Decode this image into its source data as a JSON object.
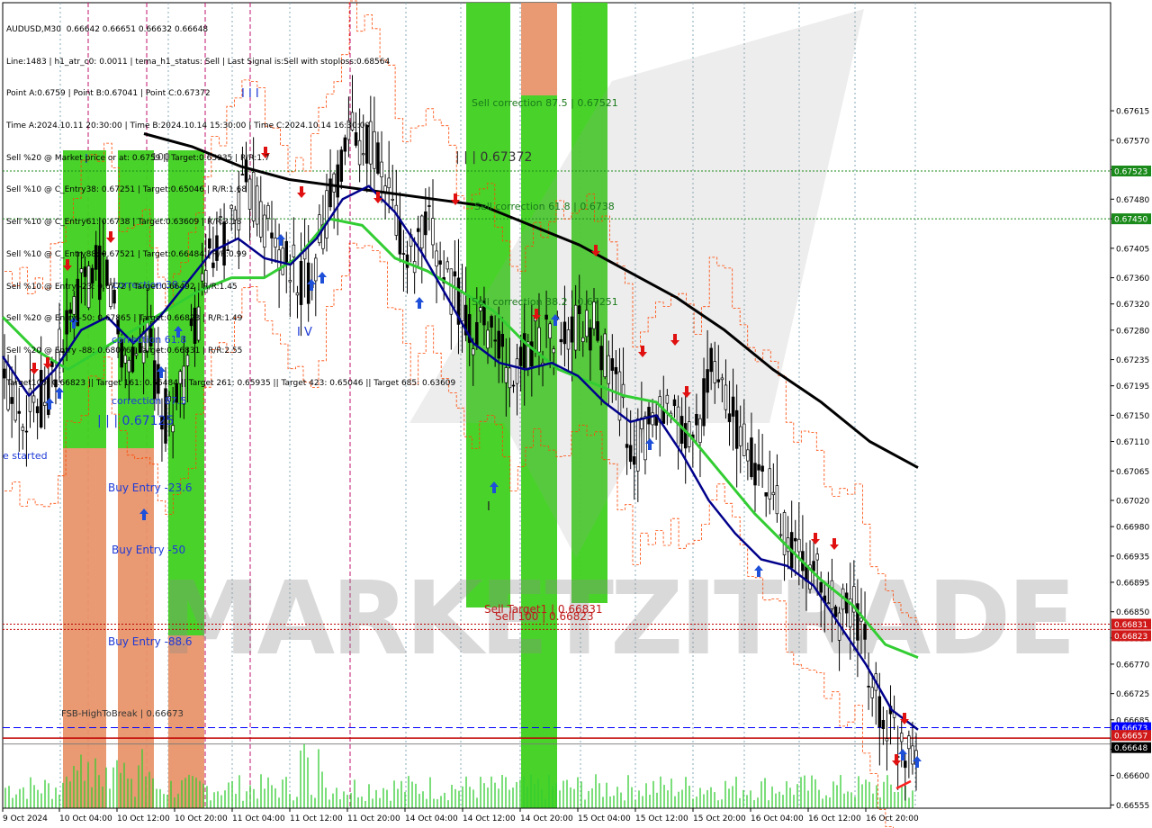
{
  "header": {
    "lines": [
      "AUDUSD,M30  0.66642 0.66651 0.66632 0.66648",
      "Line:1483 | h1_atr_c0: 0.0011 | tema_h1_status: Sell | Last Signal is:Sell with stoploss:0.68564",
      "Point A:0.6759 | Point B:0.67041 | Point C:0.67372",
      "Time A:2024.10.11 20:30:00 | Time B:2024.10.14 15:30:00 | Time C:2024.10.14 16:30:00",
      "Sell %20 @ Market price or at: 0.6759 || Target:0.65935 | R/R:1.7",
      "Sell %10 @ C_Entry38: 0.67251 | Target:0.65046 | R/R:1.68",
      "Sell %10 @ C_Entry61: 0.6738 | Target:0.63609 | R/R:3.18",
      "Sell %10 @ C_Entry88: 0.67521 | Target:0.66484 | R/R:0.99",
      "Sell %10 @ Entry -23: 0.6772 | Target:0.66492 | R/R:1.45",
      "Sell %20 @ Entry -50: 0.67865 | Target:0.66823 | R/R:1.49",
      "Sell %20 @ Entry -88: 0.68076 | Target:0.66831 | R/R:2.55",
      "Target100: 0.66823 || Target 161: 0.66484 || Target 261: 0.65935 || Target 423: 0.65046 || Target 685: 0.63609"
    ]
  },
  "watermark": "MARKETZITRADE",
  "colors": {
    "background": "#ffffff",
    "candle": "#000000",
    "ema_fast": "#00008b",
    "ema_mid": "#32cd32",
    "ema_slow": "#000000",
    "channel": "#ff4500",
    "zone_green": "#3fd11f",
    "zone_orange": "#e8956a",
    "buy_arrow": "#1e4fd8",
    "sell_arrow": "#e01010",
    "line_green": "#1a8a1a",
    "line_red": "#c00000",
    "line_blue": "#0000ff",
    "badge_green": "#1a8a1a",
    "badge_red": "#d01818",
    "badge_blue": "#0000ff",
    "badge_black": "#000000",
    "volume": "#32cd32",
    "grid": "#87a9b8",
    "session": "#c0106e",
    "text_blue": "#1e3ad6",
    "text_green": "#1a7a1a",
    "text_red": "#c01818",
    "text_dark": "#333333"
  },
  "chart_data": {
    "type": "candlestick",
    "symbol": "AUDUSD",
    "timeframe": "M30",
    "ylim": [
      0.6655,
      0.6778
    ],
    "y_ticks": [
      "0.67615",
      "0.67570",
      "0.67525",
      "0.67480",
      "0.67450",
      "0.67405",
      "0.67360",
      "0.67320",
      "0.67280",
      "0.67235",
      "0.67195",
      "0.67150",
      "0.67110",
      "0.67065",
      "0.67020",
      "0.66980",
      "0.66935",
      "0.66895",
      "0.66850",
      "0.66810",
      "0.66770",
      "0.66725",
      "0.66685",
      "0.66640",
      "0.66600",
      "0.66555"
    ],
    "x_ticks": [
      "9 Oct 2024",
      "10 Oct 04:00",
      "10 Oct 12:00",
      "10 Oct 20:00",
      "11 Oct 04:00",
      "11 Oct 12:00",
      "11 Oct 20:00",
      "14 Oct 04:00",
      "14 Oct 12:00",
      "14 Oct 20:00",
      "15 Oct 04:00",
      "15 Oct 12:00",
      "15 Oct 20:00",
      "16 Oct 04:00",
      "16 Oct 12:00",
      "16 Oct 20:00"
    ],
    "price_path": [
      [
        0.672,
        0.6716
      ],
      [
        0.6716,
        0.6714
      ],
      [
        0.6718,
        0.6723
      ],
      [
        0.6727,
        0.6733
      ],
      [
        0.6735,
        0.674
      ],
      [
        0.6738,
        0.6725
      ],
      [
        0.6723,
        0.6729
      ],
      [
        0.6727,
        0.6719
      ],
      [
        0.6714,
        0.6718
      ],
      [
        0.6722,
        0.673
      ],
      [
        0.6737,
        0.6743
      ],
      [
        0.6743,
        0.6746
      ],
      [
        0.675,
        0.6747
      ],
      [
        0.6743,
        0.6739
      ],
      [
        0.6737,
        0.6736
      ],
      [
        0.6736,
        0.6738
      ],
      [
        0.6747,
        0.6755
      ],
      [
        0.6758,
        0.6759
      ],
      [
        0.6757,
        0.6752
      ],
      [
        0.6748,
        0.6742
      ],
      [
        0.6738,
        0.6742
      ],
      [
        0.6743,
        0.6738
      ],
      [
        0.6735,
        0.6732
      ],
      [
        0.6728,
        0.673
      ],
      [
        0.673,
        0.6722
      ],
      [
        0.6719,
        0.6725
      ],
      [
        0.6727,
        0.6722
      ],
      [
        0.6727,
        0.6728
      ],
      [
        0.6727,
        0.6726
      ],
      [
        0.6729,
        0.6728
      ],
      [
        0.6722,
        0.6713
      ],
      [
        0.671,
        0.6714
      ],
      [
        0.6713,
        0.6716
      ],
      [
        0.6714,
        0.6713
      ],
      [
        0.6711,
        0.6715
      ],
      [
        0.6723,
        0.672
      ],
      [
        0.6714,
        0.671
      ],
      [
        0.6707,
        0.6702
      ],
      [
        0.6702,
        0.6697
      ],
      [
        0.6694,
        0.6693
      ],
      [
        0.6691,
        0.669
      ],
      [
        0.6685,
        0.6686
      ],
      [
        0.6685,
        0.6675
      ],
      [
        0.6672,
        0.6665
      ],
      [
        0.6666,
        0.6662
      ],
      [
        0.6665,
        0.6665
      ]
    ],
    "series": [
      {
        "name": "EMA fast",
        "values": [
          0.6724,
          0.6718,
          0.6722,
          0.6728,
          0.673,
          0.6726,
          0.673,
          0.6735,
          0.674,
          0.6742,
          0.6739,
          0.6738,
          0.6742,
          0.6748,
          0.675,
          0.6746,
          0.674,
          0.6733,
          0.6726,
          0.6723,
          0.6722,
          0.6723,
          0.6721,
          0.6717,
          0.6714,
          0.6715,
          0.6709,
          0.6702,
          0.6697,
          0.6693,
          0.6692,
          0.6689,
          0.6683,
          0.6677,
          0.667,
          0.6667
        ]
      },
      {
        "name": "EMA mid",
        "values": [
          0.673,
          0.6725,
          0.6722,
          0.6725,
          0.6728,
          0.6731,
          0.6734,
          0.6736,
          0.6736,
          0.6739,
          0.6745,
          0.6744,
          0.6739,
          0.6737,
          0.6734,
          0.6731,
          0.6726,
          0.6722,
          0.672,
          0.6718,
          0.6717,
          0.6712,
          0.6706,
          0.67,
          0.6695,
          0.669,
          0.6686,
          0.668,
          0.6678
        ]
      },
      {
        "name": "EMA slow",
        "values": [
          0.6758,
          0.6756,
          0.6753,
          0.6751,
          0.675,
          0.6749,
          0.6748,
          0.6747,
          0.6744,
          0.6741,
          0.6737,
          0.6733,
          0.6728,
          0.6722,
          0.6717,
          0.6711,
          0.6707
        ]
      }
    ],
    "levels": [
      {
        "value": 0.67523,
        "label": "0.67523",
        "role": "sell-correction-87.5"
      },
      {
        "value": 0.6745,
        "label": "0.67450",
        "role": "level"
      },
      {
        "value": 0.66831,
        "label": "0.66831",
        "role": "sell-target-1"
      },
      {
        "value": 0.66823,
        "label": "0.66823",
        "role": "sell-100"
      },
      {
        "value": 0.66673,
        "label": "0.66673",
        "role": "fsb-high-to-break"
      },
      {
        "value": 0.66657,
        "label": "0.66657",
        "role": "stop"
      },
      {
        "value": 0.66648,
        "label": "0.66648",
        "role": "current-price"
      }
    ],
    "annotations": {
      "correction_38": "correction 38.2",
      "correction_61": "correction 61.8",
      "correction_87": "correction 87.5",
      "level_67125": "| | | 0.67125",
      "buy_entry_23": "Buy Entry -23.6",
      "buy_entry_50": "Buy Entry -50",
      "buy_entry_88": "Buy Entry -88.6",
      "started": "e started",
      "sell_corr_87": "Sell correction 87.5 | 0.67521",
      "sell_corr_61": "Sell correction 61.8 | 0.6738",
      "sell_corr_38": "Sell correction 38.2 | 0.67251",
      "level_67372": "| | | 0.67372",
      "sell_target1": "Sell Target1 | 0.66831",
      "sell_100": "Sell 100 | 0.66823",
      "fsb": "FSB-HighToBreak | 0.66673",
      "label_100": "100",
      "label_iv": "I V",
      "label_i": "I",
      "label_iii": "I I I"
    }
  }
}
